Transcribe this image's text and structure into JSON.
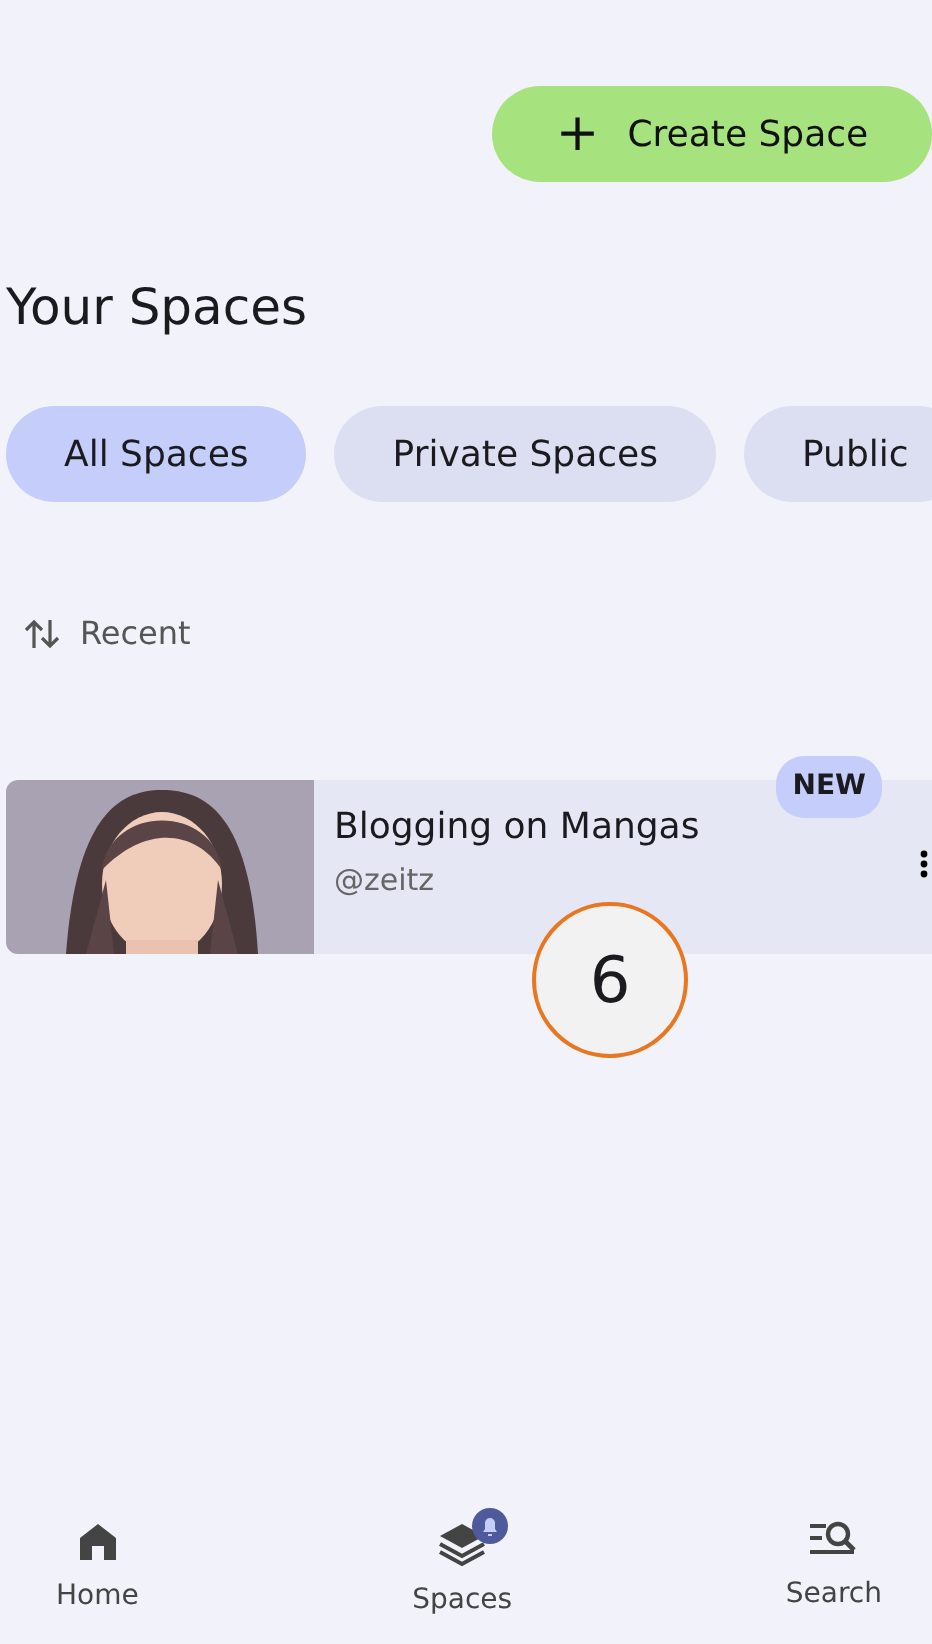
{
  "create_button": {
    "icon": "+",
    "label": "Create Space"
  },
  "title": "Your Spaces",
  "filters": [
    {
      "label": "All Spaces",
      "selected": true
    },
    {
      "label": "Private Spaces",
      "selected": false
    },
    {
      "label": "Public",
      "selected": false
    }
  ],
  "sort": {
    "label": "Recent"
  },
  "spaces": [
    {
      "kind": "picture",
      "title": "Blogging on Mangas",
      "handle": "@zeitz",
      "new_badge": "NEW"
    }
  ],
  "annotation": "6",
  "bottom_nav": [
    {
      "label": "Home",
      "notification": false
    },
    {
      "label": "Spaces",
      "notification": true
    },
    {
      "label": "Search",
      "notification": false
    }
  ]
}
